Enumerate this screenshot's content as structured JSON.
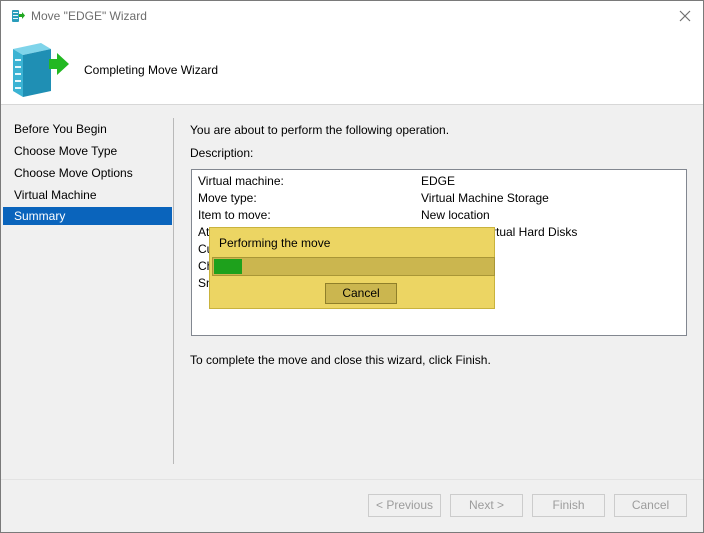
{
  "window": {
    "title": "Move \"EDGE\" Wizard"
  },
  "header": {
    "title": "Completing Move Wizard"
  },
  "nav": {
    "items": [
      {
        "label": "Before You Begin"
      },
      {
        "label": "Choose Move Type"
      },
      {
        "label": "Choose Move Options"
      },
      {
        "label": "Virtual Machine"
      },
      {
        "label": "Summary",
        "selected": true
      }
    ]
  },
  "main": {
    "intro": "You are about to perform the following operation.",
    "description_label": "Description:",
    "rows": [
      {
        "label": "Virtual machine:",
        "value": "EDGE"
      },
      {
        "label": "Move type:",
        "value": "Virtual Machine Storage"
      },
      {
        "label": "Item to move:",
        "value": "New location"
      },
      {
        "label": "At",
        "value": "rtual Hard Disks"
      },
      {
        "label": "Cu",
        "value": ""
      },
      {
        "label": "Ch",
        "value": ""
      },
      {
        "label": "Sn",
        "value": ""
      }
    ],
    "footer_text": "To complete the move and close this wizard, click Finish."
  },
  "progress_popup": {
    "title": "Performing the move",
    "progress_fraction": 0.1,
    "cancel_label": "Cancel"
  },
  "buttons": {
    "previous": "< Previous",
    "next": "Next >",
    "finish": "Finish",
    "cancel": "Cancel"
  },
  "colors": {
    "selection": "#0a64bc",
    "popup_background": "#ecd563",
    "progress_fill": "#1ea11c"
  },
  "icons": {
    "title": "server-move-icon",
    "header": "server-move-large-icon",
    "close": "close-icon"
  }
}
